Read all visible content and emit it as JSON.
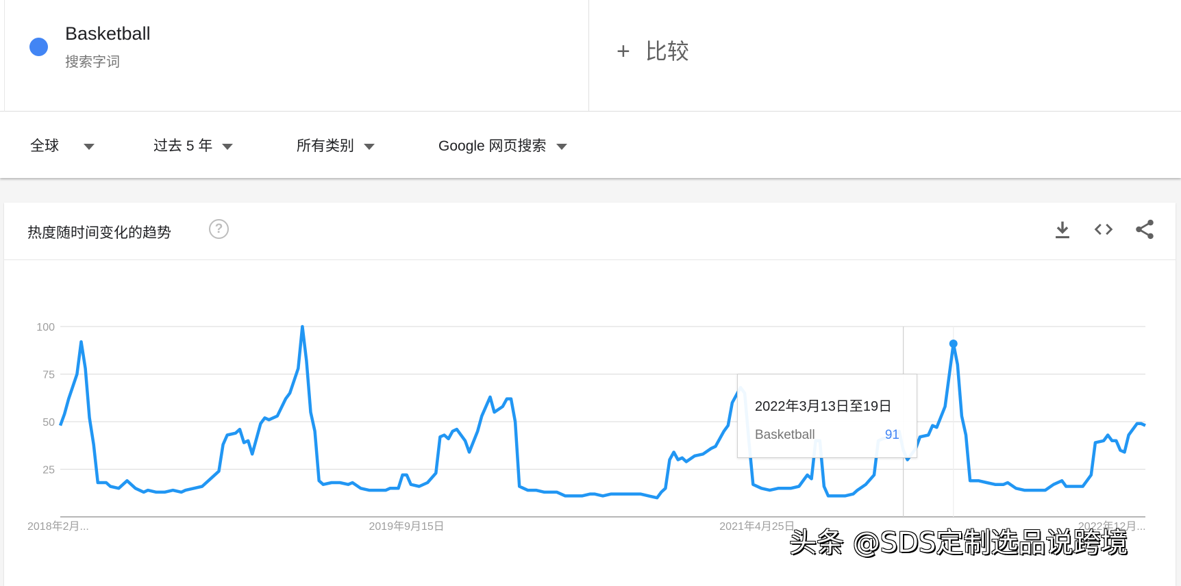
{
  "term": {
    "name": "Basketball",
    "subtitle": "搜索字词",
    "color": "#4285f4"
  },
  "compare": {
    "icon": "plus-icon",
    "plus": "+",
    "label": "比较"
  },
  "filters": [
    {
      "label": "全球"
    },
    {
      "label": "过去 5 年"
    },
    {
      "label": "所有类别"
    },
    {
      "label": "Google 网页搜索"
    }
  ],
  "card": {
    "title": "热度随时间变化的趋势",
    "help": "?",
    "icons": [
      "download-icon",
      "embed-icon",
      "share-icon"
    ]
  },
  "tooltip": {
    "date": "2022年3月13日至19日",
    "series": "Basketball",
    "value": "91"
  },
  "watermark": "头条 @SDS定制选品说跨境",
  "chart_data": {
    "type": "line",
    "title": "热度随时间变化的趋势",
    "xlabel": "",
    "ylabel": "",
    "ylim": [
      0,
      100
    ],
    "yticks": [
      "100",
      "75",
      "50",
      "25"
    ],
    "ytick_values": [
      100,
      75,
      50,
      25
    ],
    "xticks": [
      {
        "label": "2018年2月...",
        "week": 0
      },
      {
        "label": "2019年9月15日",
        "week": 83
      },
      {
        "label": "2021年4月25日",
        "week": 167
      },
      {
        "label": "2022年12月...",
        "week": 252
      }
    ],
    "x_unit": "weeks since start (Feb 2018)",
    "xlim": [
      0,
      260
    ],
    "line_color": "#2196f3",
    "highlight_week": 214,
    "hover_week": 202,
    "series": [
      {
        "name": "Basketball",
        "points": [
          [
            0,
            48
          ],
          [
            1,
            54
          ],
          [
            2,
            62
          ],
          [
            4,
            75
          ],
          [
            5,
            92
          ],
          [
            6,
            78
          ],
          [
            7,
            52
          ],
          [
            8,
            38
          ],
          [
            9,
            18
          ],
          [
            11,
            18
          ],
          [
            12,
            16
          ],
          [
            14,
            15
          ],
          [
            16,
            19
          ],
          [
            18,
            15
          ],
          [
            20,
            13
          ],
          [
            21,
            14
          ],
          [
            23,
            13
          ],
          [
            25,
            13
          ],
          [
            27,
            14
          ],
          [
            29,
            13
          ],
          [
            30,
            14
          ],
          [
            32,
            15
          ],
          [
            34,
            16
          ],
          [
            36,
            20
          ],
          [
            38,
            24
          ],
          [
            39,
            38
          ],
          [
            40,
            43
          ],
          [
            42,
            44
          ],
          [
            43,
            46
          ],
          [
            44,
            39
          ],
          [
            45,
            40
          ],
          [
            46,
            33
          ],
          [
            48,
            49
          ],
          [
            49,
            52
          ],
          [
            50,
            51
          ],
          [
            52,
            53
          ],
          [
            54,
            62
          ],
          [
            55,
            65
          ],
          [
            57,
            78
          ],
          [
            58,
            100
          ],
          [
            59,
            82
          ],
          [
            60,
            55
          ],
          [
            61,
            45
          ],
          [
            62,
            19
          ],
          [
            63,
            17
          ],
          [
            65,
            18
          ],
          [
            67,
            18
          ],
          [
            69,
            17
          ],
          [
            70,
            18
          ],
          [
            72,
            15
          ],
          [
            74,
            14
          ],
          [
            76,
            14
          ],
          [
            78,
            14
          ],
          [
            79,
            15
          ],
          [
            81,
            15
          ],
          [
            82,
            22
          ],
          [
            83,
            22
          ],
          [
            84,
            17
          ],
          [
            86,
            16
          ],
          [
            88,
            18
          ],
          [
            90,
            23
          ],
          [
            91,
            42
          ],
          [
            92,
            43
          ],
          [
            93,
            41
          ],
          [
            94,
            45
          ],
          [
            95,
            46
          ],
          [
            97,
            40
          ],
          [
            98,
            34
          ],
          [
            100,
            45
          ],
          [
            101,
            53
          ],
          [
            103,
            63
          ],
          [
            104,
            55
          ],
          [
            106,
            58
          ],
          [
            107,
            62
          ],
          [
            108,
            62
          ],
          [
            109,
            50
          ],
          [
            110,
            16
          ],
          [
            112,
            14
          ],
          [
            114,
            14
          ],
          [
            116,
            13
          ],
          [
            117,
            13
          ],
          [
            119,
            13
          ],
          [
            121,
            11
          ],
          [
            123,
            11
          ],
          [
            125,
            11
          ],
          [
            127,
            12
          ],
          [
            128,
            12
          ],
          [
            130,
            11
          ],
          [
            132,
            12
          ],
          [
            134,
            12
          ],
          [
            136,
            12
          ],
          [
            137,
            12
          ],
          [
            139,
            12
          ],
          [
            141,
            11
          ],
          [
            143,
            10
          ],
          [
            144,
            13
          ],
          [
            145,
            15
          ],
          [
            146,
            30
          ],
          [
            147,
            34
          ],
          [
            148,
            30
          ],
          [
            149,
            31
          ],
          [
            150,
            29
          ],
          [
            152,
            32
          ],
          [
            154,
            33
          ],
          [
            156,
            36
          ],
          [
            157,
            37
          ],
          [
            159,
            45
          ],
          [
            160,
            48
          ],
          [
            161,
            60
          ],
          [
            163,
            68
          ],
          [
            164,
            65
          ],
          [
            165,
            40
          ],
          [
            166,
            17
          ],
          [
            168,
            15
          ],
          [
            170,
            14
          ],
          [
            172,
            15
          ],
          [
            173,
            15
          ],
          [
            175,
            15
          ],
          [
            177,
            16
          ],
          [
            179,
            22
          ],
          [
            180,
            20
          ],
          [
            181,
            40
          ],
          [
            182,
            40
          ],
          [
            183,
            16
          ],
          [
            184,
            11
          ],
          [
            186,
            11
          ],
          [
            188,
            11
          ],
          [
            190,
            12
          ],
          [
            191,
            14
          ],
          [
            193,
            17
          ],
          [
            195,
            22
          ],
          [
            196,
            40
          ],
          [
            197,
            41
          ],
          [
            199,
            42
          ],
          [
            201,
            45
          ],
          [
            202,
            35
          ],
          [
            203,
            30
          ],
          [
            205,
            36
          ],
          [
            206,
            42
          ],
          [
            208,
            43
          ],
          [
            209,
            48
          ],
          [
            210,
            47
          ],
          [
            212,
            58
          ],
          [
            214,
            91
          ],
          [
            215,
            80
          ],
          [
            216,
            53
          ],
          [
            217,
            43
          ],
          [
            218,
            19
          ],
          [
            220,
            19
          ],
          [
            222,
            18
          ],
          [
            224,
            17
          ],
          [
            226,
            17
          ],
          [
            227,
            18
          ],
          [
            229,
            15
          ],
          [
            231,
            14
          ],
          [
            233,
            14
          ],
          [
            235,
            14
          ],
          [
            236,
            14
          ],
          [
            238,
            17
          ],
          [
            240,
            19
          ],
          [
            241,
            16
          ],
          [
            243,
            16
          ],
          [
            245,
            16
          ],
          [
            246,
            19
          ],
          [
            247,
            22
          ],
          [
            248,
            39
          ],
          [
            250,
            40
          ],
          [
            251,
            43
          ],
          [
            252,
            40
          ],
          [
            253,
            40
          ],
          [
            254,
            35
          ],
          [
            255,
            34
          ],
          [
            256,
            43
          ],
          [
            258,
            49
          ],
          [
            259,
            49
          ],
          [
            260,
            48
          ]
        ]
      }
    ]
  }
}
